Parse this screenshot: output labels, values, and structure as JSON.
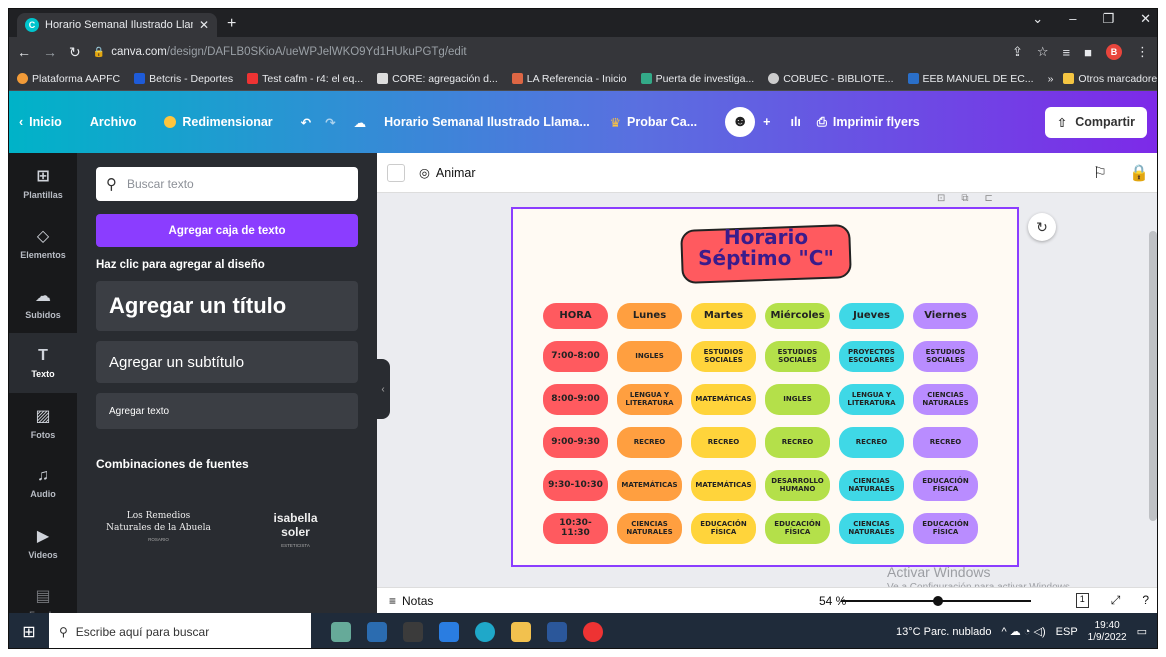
{
  "browser": {
    "tab_title": "Horario Semanal Ilustrado Llama",
    "url_host": "canva.com",
    "url_path": "/design/DAFLB0SKioA/ueWPJelWKO9Yd1HUkuPGTg/edit",
    "profile_initial": "B",
    "bookmarks": [
      "Plataforma AAPFC",
      "Betcris - Deportes",
      "Test cafm - r4: el eq...",
      "CORE: agregación d...",
      "LA Referencia - Inicio",
      "Puerta de investiga...",
      "COBUEC - BIBLIOTE...",
      "EEB MANUEL DE EC..."
    ],
    "bookmark_more": "»",
    "bookmark_other": "Otros marcadores"
  },
  "canva_bar": {
    "home": "Inicio",
    "file": "Archivo",
    "resize": "Redimensionar",
    "doc_title": "Horario Semanal Ilustrado Llama...",
    "try_pro": "Probar Ca...",
    "print": "Imprimir flyers",
    "share": "Compartir"
  },
  "rail": [
    "Plantillas",
    "Elementos",
    "Subidos",
    "Texto",
    "Fotos",
    "Audio",
    "Videos",
    "Fondo"
  ],
  "panel": {
    "search_placeholder": "Buscar texto",
    "add_box": "Agregar caja de texto",
    "hint": "Haz clic para agregar al diseño",
    "title": "Agregar un título",
    "subtitle": "Agregar un subtítulo",
    "body": "Agregar texto",
    "combos": "Combinaciones de fuentes",
    "card1": {
      "l1": "Los Remedios",
      "l2": "Naturales de la Abuela",
      "l3": "ROSARIO"
    },
    "card2": {
      "l1": "isabella",
      "l2": "soler",
      "l3": "ESTETICISTA"
    }
  },
  "editor": {
    "animate": "Animar",
    "notes": "Notas",
    "zoom": "54 %",
    "page_num": "1",
    "watermark1": "Activar Windows",
    "watermark2": "Ve a Configuración para activar Windows."
  },
  "schedule": {
    "title1": "Horario",
    "title2": "Séptimo \"C\"",
    "headers": [
      "HORA",
      "Lunes",
      "Martes",
      "Miércoles",
      "Jueves",
      "Viernes"
    ],
    "header_colors": [
      "#ff5a5f",
      "#ff9f40",
      "#ffd43b",
      "#b4e04a",
      "#3fd8e6",
      "#b98cff"
    ],
    "rows": [
      [
        "7:00-8:00",
        "INGLES",
        "ESTUDIOS SOCIALES",
        "ESTUDIOS SOCIALES",
        "PROYECTOS ESCOLARES",
        "ESTUDIOS SOCIALES"
      ],
      [
        "8:00-9:00",
        "LENGUA Y LITERATURA",
        "MATEMÁTICAS",
        "INGLES",
        "LENGUA Y LITERATURA",
        "CIENCIAS NATURALES"
      ],
      [
        "9:00-9:30",
        "RECREO",
        "RECREO",
        "RECREO",
        "RECREO",
        "RECREO"
      ],
      [
        "9:30-10:30",
        "MATEMÁTICAS",
        "MATEMÁTICAS",
        "DESARROLLO HUMANO",
        "CIENCIAS NATURALES",
        "EDUCACIÓN FÍSICA"
      ],
      [
        "10:30-11:30",
        "CIENCIAS NATURALES",
        "EDUCACIÓN FÍSICA",
        "EDUCACIÓN FÍSICA",
        "CIENCIAS NATURALES",
        "EDUCACIÓN FÍSICA"
      ]
    ]
  },
  "taskbar": {
    "search_placeholder": "Escribe aquí para buscar",
    "weather": "13°C  Parc. nublado",
    "lang": "ESP",
    "time": "19:40",
    "date": "1/9/2022"
  }
}
